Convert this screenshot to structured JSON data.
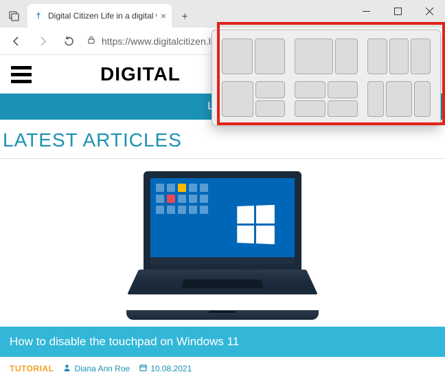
{
  "window": {
    "tab_title": "Digital Citizen Life in a digital wo",
    "url": "https://www.digitalcitizen.li"
  },
  "page": {
    "brand": "DIGITAL",
    "nav_latest": "Latest",
    "section_heading": "LATEST ARTICLES"
  },
  "article": {
    "title": "How to disable the touchpad on Windows 11",
    "category": "TUTORIAL",
    "author": "Diana Ann Roe",
    "date": "10.08.2021"
  },
  "icons": {
    "tab_close": "×",
    "new_tab": "+",
    "favicon": "†"
  }
}
